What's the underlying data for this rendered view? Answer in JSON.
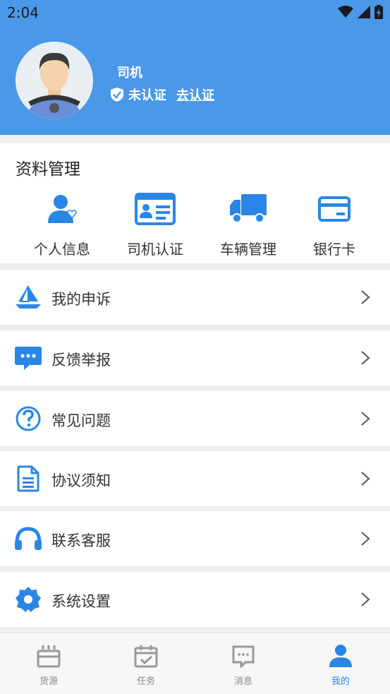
{
  "status": {
    "time": "2:04"
  },
  "profile": {
    "name": "司机",
    "cert_status": "未认证",
    "cert_action": "去认证"
  },
  "data_section": {
    "title": "资料管理",
    "items": [
      {
        "label": "个人信息",
        "icon": "person-heart-icon"
      },
      {
        "label": "司机认证",
        "icon": "id-card-icon"
      },
      {
        "label": "车辆管理",
        "icon": "truck-icon"
      },
      {
        "label": "银行卡",
        "icon": "bank-card-icon"
      }
    ]
  },
  "menu": [
    {
      "label": "我的申诉",
      "icon": "boat-icon"
    },
    {
      "label": "反馈举报",
      "icon": "chat-bubble-icon"
    },
    {
      "label": "常见问题",
      "icon": "question-icon"
    },
    {
      "label": "协议须知",
      "icon": "document-icon"
    },
    {
      "label": "联系客服",
      "icon": "headset-icon"
    },
    {
      "label": "系统设置",
      "icon": "gear-icon"
    }
  ],
  "nav": [
    {
      "label": "货源",
      "icon": "box-icon",
      "active": false
    },
    {
      "label": "任务",
      "icon": "calendar-check-icon",
      "active": false
    },
    {
      "label": "消息",
      "icon": "message-icon",
      "active": false
    },
    {
      "label": "我的",
      "icon": "user-icon",
      "active": true
    }
  ],
  "colors": {
    "brand": "#4a98e8",
    "icon_blue": "#2a86e6",
    "nav_active": "#2a86e6"
  }
}
